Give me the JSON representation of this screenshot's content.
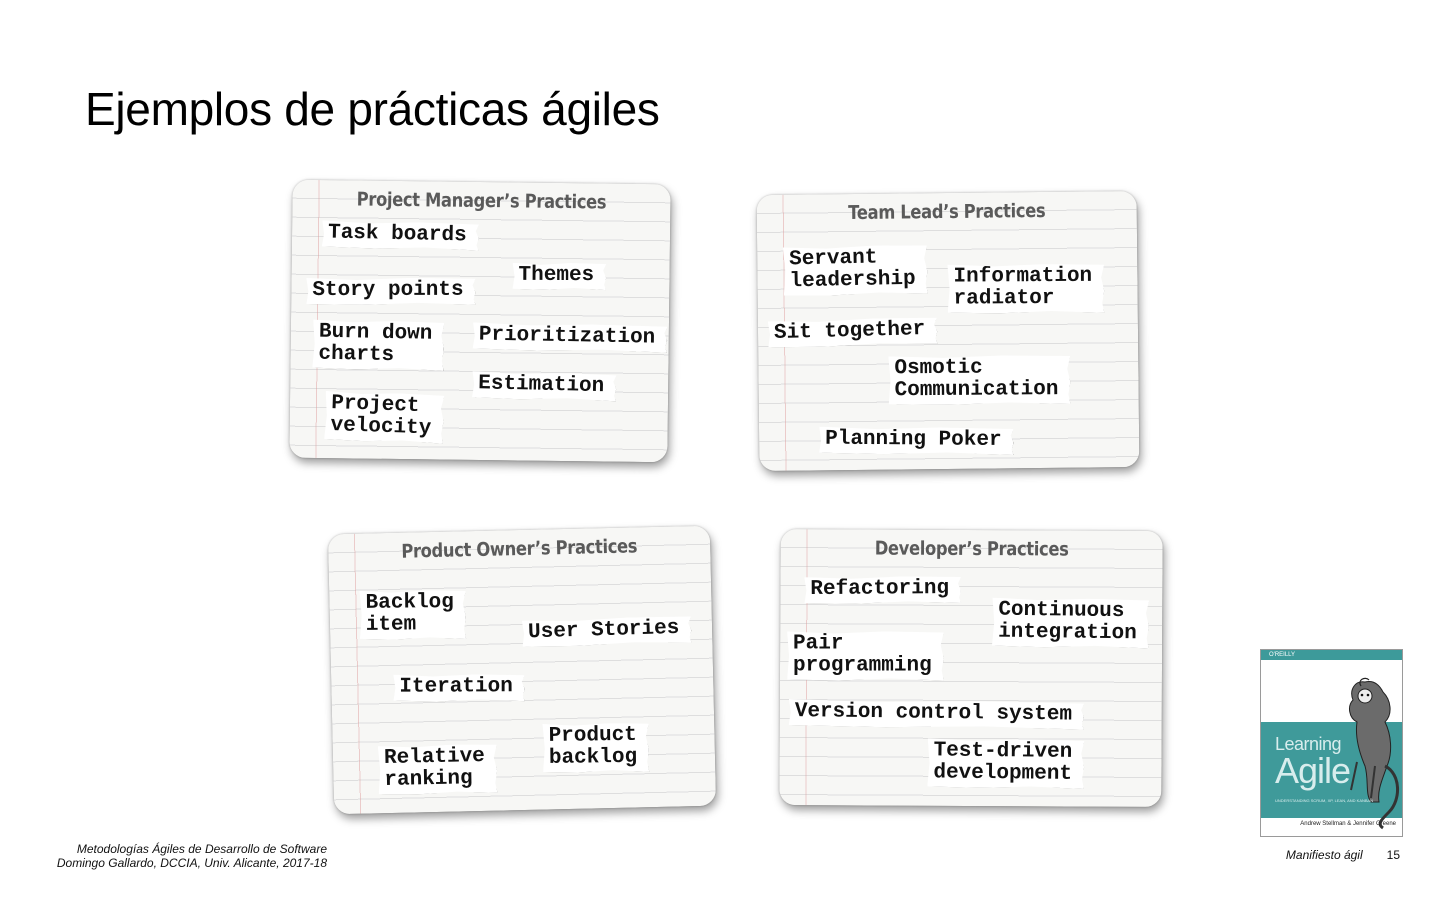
{
  "slide": {
    "title": "Ejemplos de prácticas ágiles"
  },
  "cards": {
    "pm": {
      "title": "Project Manager’s Practices",
      "tags": [
        "Task boards",
        "Themes",
        "Story points",
        "Burn down\ncharts",
        "Prioritization",
        "Estimation",
        "Project\nvelocity"
      ]
    },
    "tl": {
      "title": "Team Lead’s Practices",
      "tags": [
        "Servant\nleadership",
        "Information\nradiator",
        "Sit together",
        "Osmotic\nCommunication",
        "Planning Poker"
      ]
    },
    "po": {
      "title": "Product Owner’s Practices",
      "tags": [
        "Backlog\nitem",
        "User Stories",
        "Iteration",
        "Product\nbacklog",
        "Relative\nranking"
      ]
    },
    "dev": {
      "title": "Developer’s Practices",
      "tags": [
        "Refactoring",
        "Continuous\nintegration",
        "Pair\nprogramming",
        "Version control system",
        "Test-driven\ndevelopment"
      ]
    }
  },
  "book": {
    "publisher": "O'REILLY",
    "title_line1": "Learning",
    "title_line2": "Agile",
    "subtitle": "UNDERSTANDING SCRUM, XP, LEAN, AND KANBAN",
    "authors": "Andrew Stellman & Jennifer Greene"
  },
  "footer": {
    "course_line1": "Metodologías Ágiles de Desarrollo de Software",
    "course_line2": "Domingo Gallardo, DCCIA, Univ. Alicante, 2017-18",
    "section": "Manifiesto ágil",
    "page_number": "15"
  }
}
